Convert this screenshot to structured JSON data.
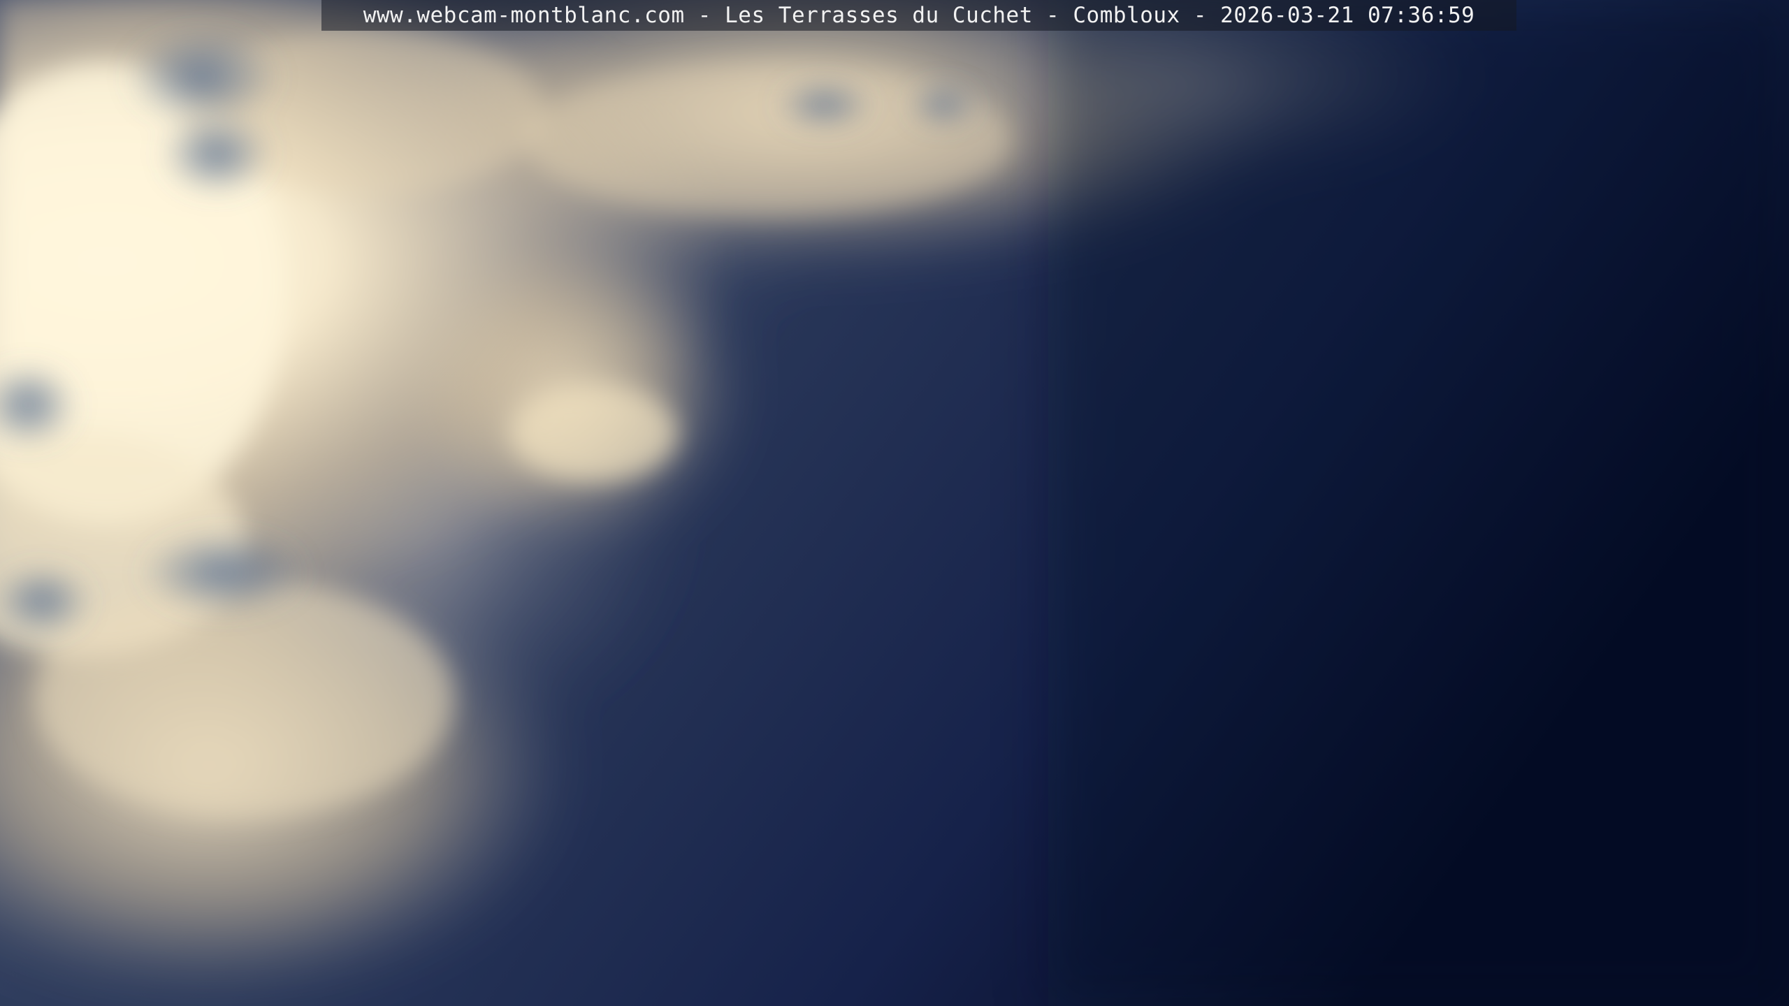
{
  "webcam": {
    "caption": "www.webcam-montblanc.com - Les Terrasses du Cuchet - Combloux - 2026-03-21 07:36:59",
    "scene": {
      "sky_dark": "#0b1430",
      "sky_mid": "#2c3c5e",
      "cloud_bright": "#fff6dc",
      "cloud_warm": "#e9d7b6",
      "cloud_grey": "#8a8f9e"
    }
  }
}
